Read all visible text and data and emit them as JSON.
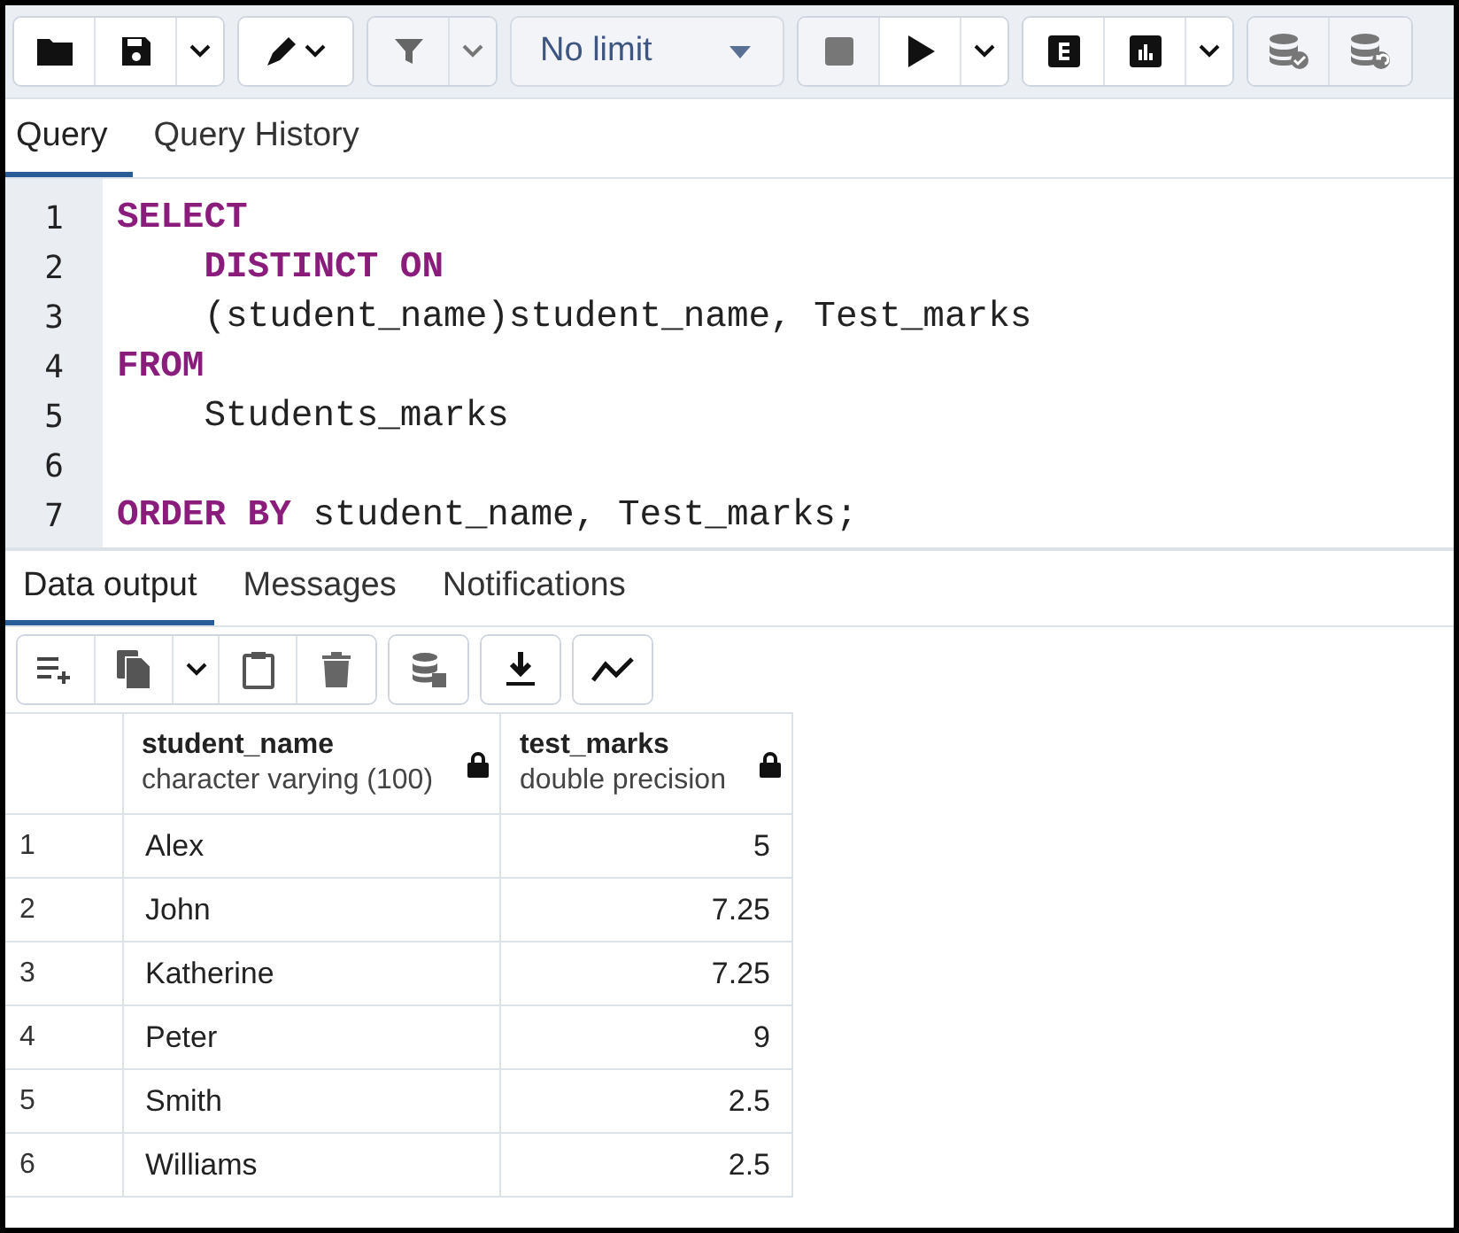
{
  "toolbar": {
    "limit": "No limit"
  },
  "query_tabs": [
    {
      "label": "Query",
      "selected": true
    },
    {
      "label": "Query History",
      "selected": false
    }
  ],
  "editor": {
    "lines": [
      {
        "number": "1",
        "tokens": [
          {
            "kind": "keyword",
            "text": "SELECT"
          }
        ]
      },
      {
        "number": "2",
        "tokens": [
          {
            "kind": "keyword",
            "text": "    DISTINCT ON"
          }
        ]
      },
      {
        "number": "3",
        "tokens": [
          {
            "kind": "plain",
            "text": "    (student_name)student_name, Test_marks"
          }
        ]
      },
      {
        "number": "4",
        "tokens": [
          {
            "kind": "keyword",
            "text": "FROM"
          }
        ]
      },
      {
        "number": "5",
        "tokens": [
          {
            "kind": "plain",
            "text": "    Students_marks"
          }
        ]
      },
      {
        "number": "6"
      },
      {
        "number": "7",
        "tokens": [
          {
            "kind": "keyword",
            "text": "ORDER BY"
          },
          {
            "kind": "plain",
            "text": " student_name, Test_marks;"
          }
        ]
      }
    ]
  },
  "output_tabs": [
    {
      "label": "Data output",
      "selected": true
    },
    {
      "label": "Messages",
      "selected": false
    },
    {
      "label": "Notifications",
      "selected": false
    }
  ],
  "table": {
    "columns": [
      {
        "name": "student_name",
        "type": "character varying (100)",
        "kind": "text"
      },
      {
        "name": "test_marks",
        "type": "double precision",
        "kind": "number"
      }
    ],
    "rows": [
      {
        "index": "1",
        "cells": [
          "Alex",
          "5"
        ]
      },
      {
        "index": "2",
        "cells": [
          "John",
          "7.25"
        ]
      },
      {
        "index": "3",
        "cells": [
          "Katherine",
          "7.25"
        ]
      },
      {
        "index": "4",
        "cells": [
          "Peter",
          "9"
        ]
      },
      {
        "index": "5",
        "cells": [
          "Smith",
          "2.5"
        ]
      },
      {
        "index": "6",
        "cells": [
          "Williams",
          "2.5"
        ]
      }
    ]
  }
}
